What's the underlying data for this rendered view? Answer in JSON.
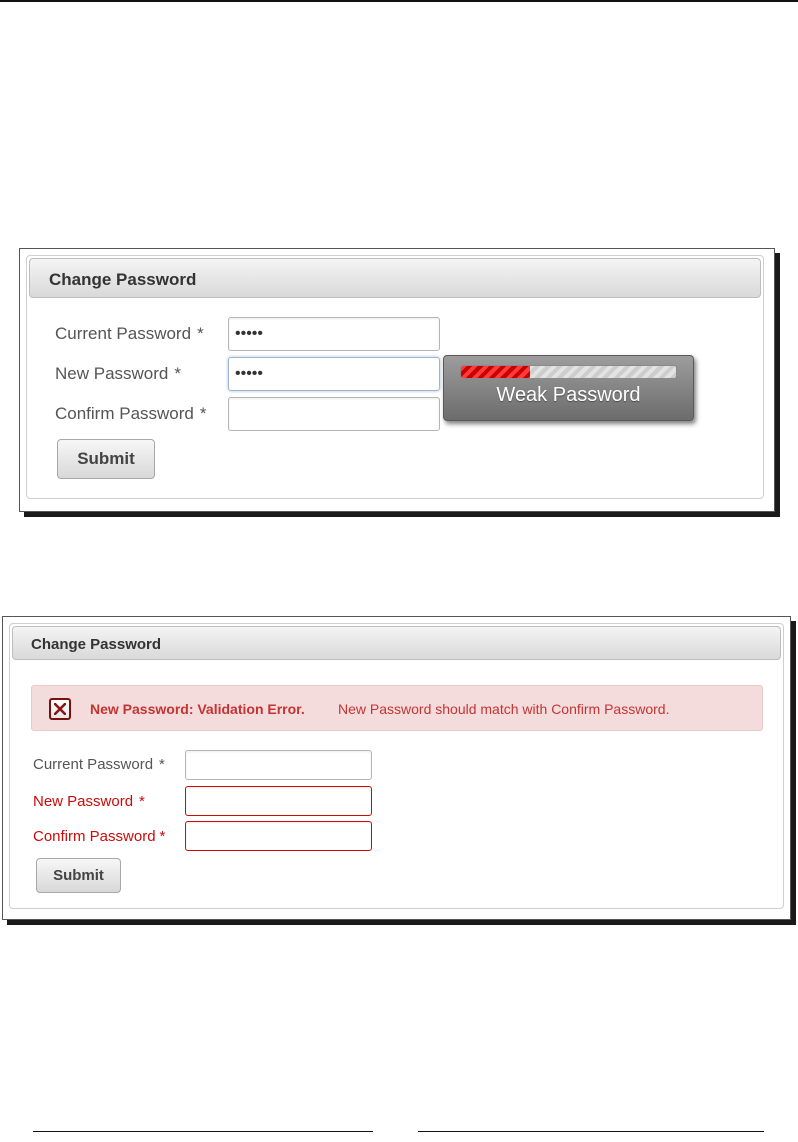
{
  "figure_top": {
    "panel_title": "Change Password",
    "fields": [
      {
        "label": "Current Password",
        "required_mark": "*",
        "value": "•••••"
      },
      {
        "label": "New Password",
        "required_mark": "*",
        "value": "•••••"
      },
      {
        "label": "Confirm Password",
        "required_mark": "*",
        "value": ""
      }
    ],
    "submit_label": "Submit",
    "strength_tooltip": {
      "text": "Weak Password",
      "level_percent": 32
    }
  },
  "figure_bottom": {
    "panel_title": "Change Password",
    "message": {
      "summary": "New Password: Validation Error.",
      "detail": "New Password should match with Confirm Password."
    },
    "fields": [
      {
        "label": "Current Password",
        "required_mark": "*",
        "value": "",
        "state": "normal"
      },
      {
        "label": "New Password",
        "required_mark": "*",
        "value": "",
        "state": "error"
      },
      {
        "label": "Confirm Password",
        "required_mark": "*",
        "value": "",
        "state": "error"
      }
    ],
    "submit_label": "Submit"
  },
  "colors": {
    "error_text": "#cd0a0a",
    "message_background": "#f5dcdc",
    "meter_fill": "#e81c1c",
    "tooltip_background": "#7d7d7d"
  },
  "icons": {
    "message_icon": "error-x-icon"
  }
}
